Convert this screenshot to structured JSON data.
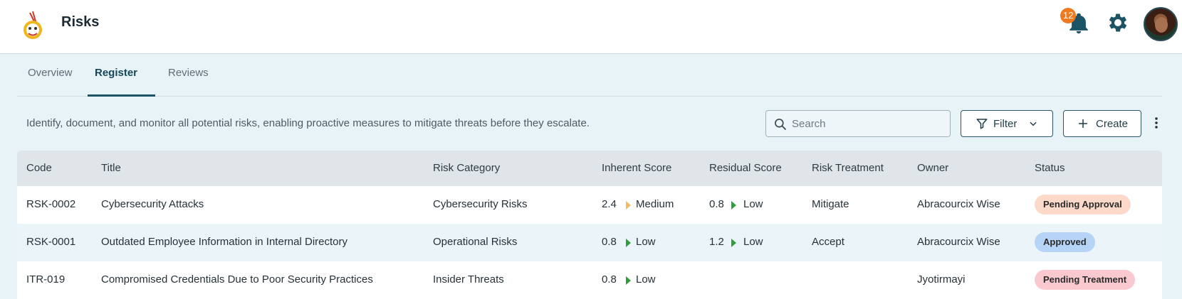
{
  "header": {
    "title": "Risks",
    "notification_count": "12",
    "icons": {
      "logo": "app-logo",
      "bell": "bell-icon",
      "gear": "gear-icon",
      "avatar": "user-avatar"
    }
  },
  "tabs": [
    {
      "label": "Overview",
      "active": false
    },
    {
      "label": "Register",
      "active": true
    },
    {
      "label": "Reviews",
      "active": false
    }
  ],
  "toolbar": {
    "description": "Identify, document, and monitor all potential risks, enabling proactive measures to mitigate threats before they escalate.",
    "search_placeholder": "Search",
    "search_value": "",
    "filter_label": "Filter",
    "create_label": "Create"
  },
  "table": {
    "columns": [
      "Code",
      "Title",
      "Risk Category",
      "Inherent Score",
      "Residual Score",
      "Risk Treatment",
      "Owner",
      "Status"
    ],
    "rows": [
      {
        "code": "RSK-0002",
        "title": "Cybersecurity Attacks",
        "category": "Cybersecurity Risks",
        "inherent_value": "2.4",
        "inherent_level": "Medium",
        "residual_value": "0.8",
        "residual_level": "Low",
        "treatment": "Mitigate",
        "owner": "Abracourcix Wise",
        "status": "Pending Approval"
      },
      {
        "code": "RSK-0001",
        "title": "Outdated Employee Information in Internal Directory",
        "category": "Operational Risks",
        "inherent_value": "0.8",
        "inherent_level": "Low",
        "residual_value": "1.2",
        "residual_level": "Low",
        "treatment": "Accept",
        "owner": "Abracourcix Wise",
        "status": "Approved"
      },
      {
        "code": "ITR-019",
        "title": "Compromised Credentials Due to Poor Security Practices",
        "category": "Insider Threats",
        "inherent_value": "0.8",
        "inherent_level": "Low",
        "residual_value": "",
        "residual_level": "",
        "treatment": "",
        "owner": "Jyotirmayi",
        "status": "Pending Treatment"
      }
    ]
  },
  "colors": {
    "accent": "#1c5466",
    "level_low": "#2e9e3a",
    "level_medium": "#f2bb63",
    "status_pending_approval": "#fcd9c9",
    "status_approved": "#b6d4f6",
    "status_pending_treatment": "#f9c9cf"
  }
}
